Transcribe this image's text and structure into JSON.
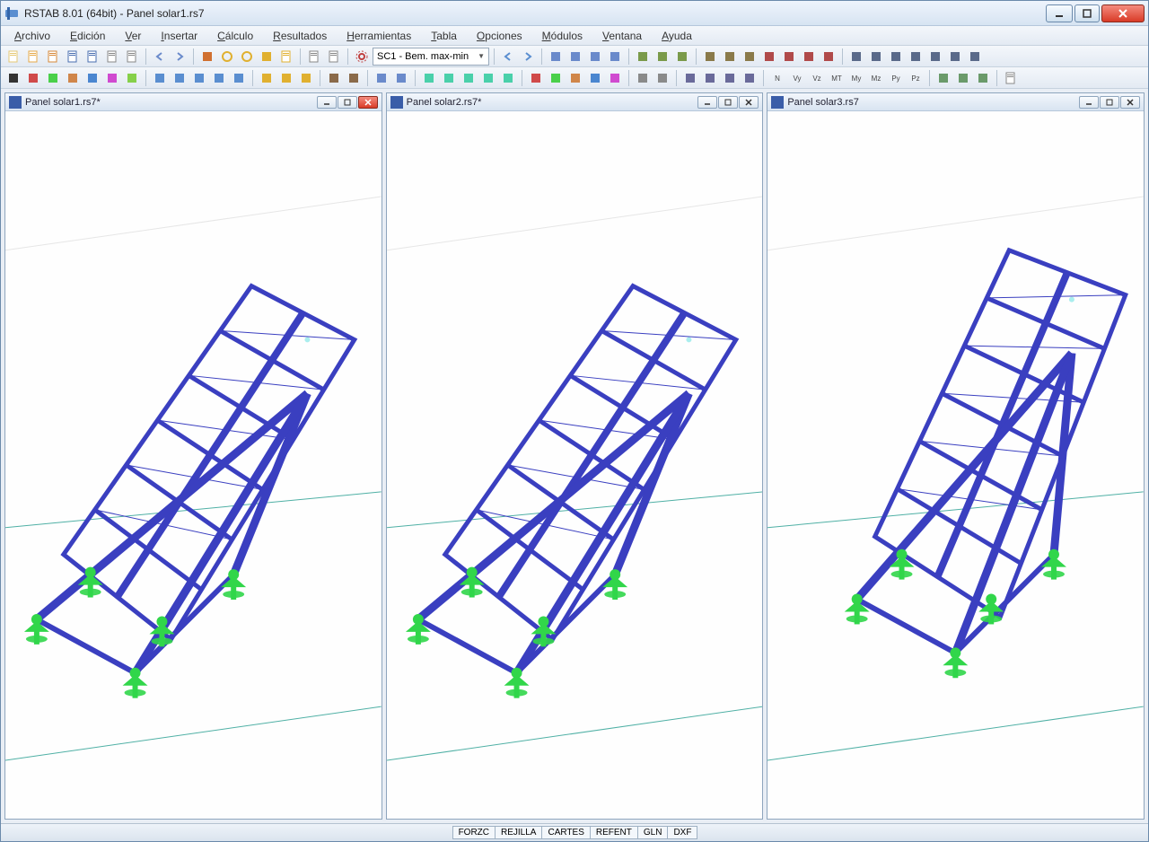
{
  "app": {
    "title": "RSTAB 8.01 (64bit) - Panel solar1.rs7"
  },
  "menus": [
    "Archivo",
    "Edición",
    "Ver",
    "Insertar",
    "Cálculo",
    "Resultados",
    "Herramientas",
    "Tabla",
    "Opciones",
    "Módulos",
    "Ventana",
    "Ayuda"
  ],
  "combo_value": "SC1 - Bem. max-min",
  "status_cells": [
    "FORZC",
    "REJILLA",
    "CARTES",
    "REFENT",
    "GLN",
    "DXF"
  ],
  "docs": [
    {
      "title": "Panel solar1.rs7*",
      "close_red": true,
      "skew": 0
    },
    {
      "title": "Panel solar2.rs7*",
      "close_red": false,
      "skew": 0
    },
    {
      "title": "Panel solar3.rs7",
      "close_red": false,
      "skew": 1
    }
  ],
  "toolbar2_labels": [
    "N",
    "Vy",
    "Vz",
    "MT",
    "My",
    "Mz",
    "Py",
    "Pz"
  ],
  "colors": {
    "frame": "#3a3fc0",
    "support": "#31d64a",
    "ground": "#4fb0a5"
  }
}
